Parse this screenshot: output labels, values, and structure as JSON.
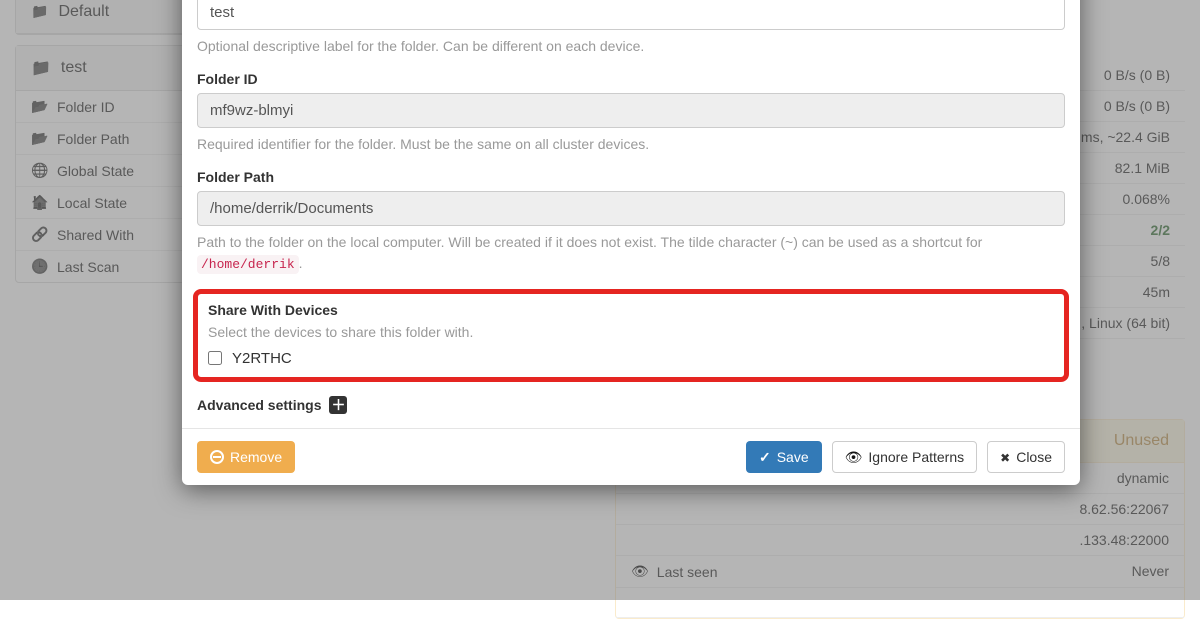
{
  "bg_left": {
    "default_folder": "Default",
    "test_folder": "test",
    "rows": {
      "folder_id": "Folder ID",
      "folder_path": "Folder Path",
      "global_state": "Global State",
      "local_state": "Local State",
      "shared_with": "Shared With",
      "last_scan": "Last Scan"
    }
  },
  "bg_right": {
    "rows": {
      "down_rate": "0 B/s (0 B)",
      "up_rate": "0 B/s (0 B)",
      "ram": "ms, ~22.4 GiB",
      "cpu": "82.1 MiB",
      "pct": "0.068%",
      "conn": "2/2",
      "listen": "5/8",
      "uptime": "45m",
      "os": ", Linux (64 bit)"
    },
    "unused_title": "Unused",
    "remote1": {
      "label": "",
      "value": "dynamic"
    },
    "remote2": {
      "label": "",
      "value": "8.62.56:22067"
    },
    "remote3": {
      "label": "",
      "value": ".133.48:22000"
    },
    "last_seen": {
      "label": "Last seen",
      "value": "Never"
    }
  },
  "modal": {
    "label_value": "test",
    "label_help": "Optional descriptive label for the folder. Can be different on each device.",
    "folder_id_label": "Folder ID",
    "folder_id_value": "mf9wz-blmyi",
    "folder_id_help": "Required identifier for the folder. Must be the same on all cluster devices.",
    "folder_path_label": "Folder Path",
    "folder_path_value": "/home/derrik/Documents",
    "folder_path_help_a": "Path to the folder on the local computer. Will be created if it does not exist. The tilde character (~) can be used as a shortcut for ",
    "folder_path_help_code": "/home/derrik",
    "folder_path_help_b": ".",
    "share_title": "Share With Devices",
    "share_help": "Select the devices to share this folder with.",
    "share_device": "Y2RTHC",
    "adv_label": "Advanced settings",
    "btn_remove": "Remove",
    "btn_save": "Save",
    "btn_ignore": "Ignore Patterns",
    "btn_close": "Close"
  }
}
